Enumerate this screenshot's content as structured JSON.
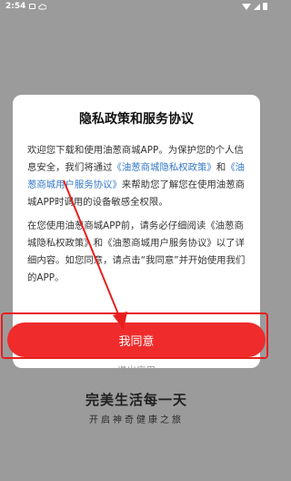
{
  "status_bar": {
    "time": "2:54",
    "icons": [
      "notification-box-icon",
      "cloud-icon",
      "wifi-icon",
      "signal-icon",
      "battery-icon"
    ]
  },
  "dialog": {
    "title": "隐私政策和服务协议",
    "paragraph1": {
      "part1": "欢迎您下载和使用油葱商城APP。为保护您的个人信息安全，我们将通过",
      "link1": "《油葱商城隐私权政策》",
      "part2": "和",
      "link2": "《油葱商城用户服务协议》",
      "part3": "来帮助您了解您在使用油葱商城APP时调用的设备敏感全权限。"
    },
    "paragraph2": {
      "text": "在您使用油葱商城APP前，请务必仔细阅读《油葱商城隐私权政策》和《油葱商城用户服务协议》以了详细内容。如您同意，请点击“我同意”并开始使用我们的APP。"
    },
    "agree_label": "我同意",
    "exit_label": "退出应用"
  },
  "splash": {
    "slogan": "完美生活每一天",
    "subtitle": "开启神奇健康之旅"
  },
  "colors": {
    "accent_red": "#ef2b2b",
    "link_blue": "#3478c6",
    "overlay": "#9b9b9b"
  }
}
